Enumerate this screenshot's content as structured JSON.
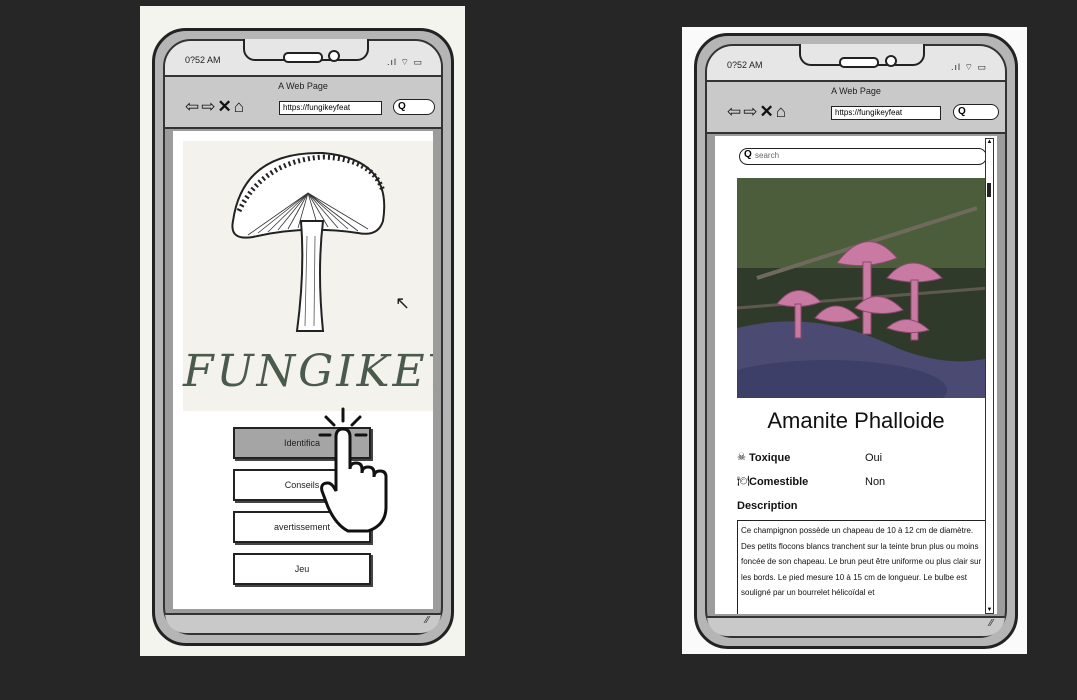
{
  "left_phone": {
    "status_time": "0?52 AM",
    "page_title": "A Web Page",
    "url": "https://fungikeyfeat",
    "search_glyph": "Q",
    "logo_text": "FUNGIKEY",
    "menu": [
      "Identifica",
      "Conseils",
      "avertissement",
      "Jeu"
    ]
  },
  "right_phone": {
    "status_time": "0?52 AM",
    "page_title": "A Web Page",
    "url": "https://fungikeyfeat",
    "search_glyph": "Q",
    "search_placeholder": "search",
    "species_title": "Amanite Phalloide",
    "rows": [
      {
        "icon": "☠",
        "label": "Toxique",
        "value": "Oui"
      },
      {
        "icon": "🍽",
        "label": "Comestible",
        "value": "Non"
      }
    ],
    "description_label": "Description",
    "description_text": "Ce champignon possède un chapeau de 10 à 12 cm de diamètre. Des petits flocons blancs tranchent sur la teinte brun plus ou moins foncée de son chapeau. Le brun peut être uniforme ou plus clair sur les bords. Le pied mesure 10 à 15 cm de longueur. Le bulbe est souligné par un bourrelet hélicoïdal et"
  },
  "colors": {
    "background": "#262626",
    "phone_body": "#b5b5b5",
    "active_button": "#a5a5a5",
    "logo_green": "#4a5a4d",
    "mushroom_pink": "#c97aa3"
  }
}
